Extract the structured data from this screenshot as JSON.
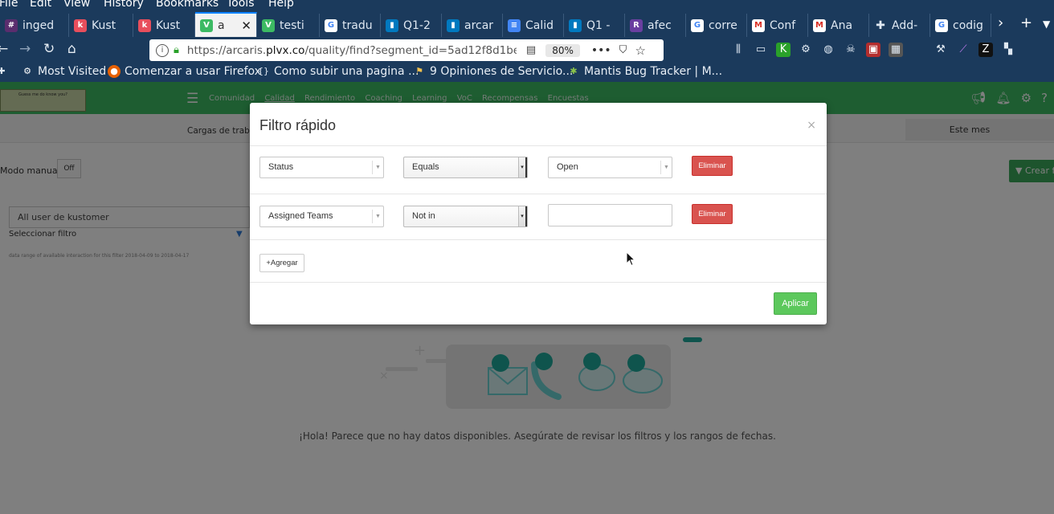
{
  "browser": {
    "menu": [
      "File",
      "Edit",
      "View",
      "History",
      "Bookmarks",
      "Tools",
      "Help"
    ],
    "tabs": [
      {
        "label": "inged",
        "icon": "hash-icon",
        "color": "#5a2d6e"
      },
      {
        "label": "Kust",
        "icon": "kustomer-icon",
        "color": "#e84e5c"
      },
      {
        "label": "Kust",
        "icon": "kustomer-icon",
        "color": "#e84e5c"
      },
      {
        "label": "a",
        "icon": "arcaris-icon",
        "color": "#3cba63",
        "active": true
      },
      {
        "label": "testi",
        "icon": "arcaris-icon",
        "color": "#3cba63"
      },
      {
        "label": "tradu",
        "icon": "google-icon",
        "color": "#ffffff"
      },
      {
        "label": "Q1-2",
        "icon": "trello-icon",
        "color": "#0079bf"
      },
      {
        "label": "arcar",
        "icon": "trello-icon",
        "color": "#0079bf"
      },
      {
        "label": "Calid",
        "icon": "docs-icon",
        "color": "#4285f4"
      },
      {
        "label": "Q1 -",
        "icon": "trello-icon",
        "color": "#0079bf"
      },
      {
        "label": "afec",
        "icon": "rainbow-icon",
        "color": "#6a3fa0"
      },
      {
        "label": "corre",
        "icon": "google-icon",
        "color": "#ffffff"
      },
      {
        "label": "Conf",
        "icon": "gmail-icon",
        "color": "#ffffff"
      },
      {
        "label": "Ana",
        "icon": "gmail-icon",
        "color": "#ffffff"
      },
      {
        "label": "Add-",
        "icon": "puzzle-icon",
        "color": "#dfe8f2"
      },
      {
        "label": "codig",
        "icon": "google-icon",
        "color": "#ffffff"
      }
    ],
    "url_prefix": "https://arcaris.",
    "url_domain": "plvx.co",
    "url_path": "/quality/find?segment_id=5ad12f8d1be",
    "zoom": "80%",
    "bookmarks": [
      {
        "label": "Most Visited",
        "icon": "gear-icon"
      },
      {
        "label": "Comenzar a usar Firefox",
        "icon": "firefox-icon"
      },
      {
        "label": "Como subir una pagina ...",
        "icon": "bracket-icon"
      },
      {
        "label": "9 Opiniones de Servicio...",
        "icon": "flag-icon"
      },
      {
        "label": "Mantis Bug Tracker | M...",
        "icon": "mantis-icon"
      }
    ]
  },
  "app": {
    "logo_text": "Guess me do know you?",
    "nav": [
      "Comunidad",
      "Calidad",
      "Rendimiento",
      "Coaching",
      "Learning",
      "VoC",
      "Recompensas",
      "Encuestas"
    ],
    "subbar_loads": "Cargas de traba",
    "subbar_month": "Este mes",
    "manual_label": "Modo manual",
    "off_label": "Off",
    "crear_label": "Crear f",
    "user_filter": "All user de kustomer",
    "select_filter": "Seleccionar filtro",
    "range_note": "data range of available interaction for this filter 2018-04-09 to 2018-04-17",
    "no_data": "¡Hola! Parece que no hay datos disponibles. Asegúrate de revisar los filtros y los rangos de fechas.",
    "accent": "#3cba63"
  },
  "modal": {
    "title": "Filtro rápido",
    "close": "×",
    "rows": [
      {
        "field": "Status",
        "operator": "Equals",
        "value": "Open",
        "value_type": "select",
        "delete": "Eliminar"
      },
      {
        "field": "Assigned Teams",
        "operator": "Not in",
        "value": "",
        "value_type": "input",
        "delete": "Eliminar"
      }
    ],
    "add_label": "+Agregar",
    "apply_label": "Aplicar",
    "danger_color": "#d9534f",
    "success_color": "#5cc85c"
  }
}
